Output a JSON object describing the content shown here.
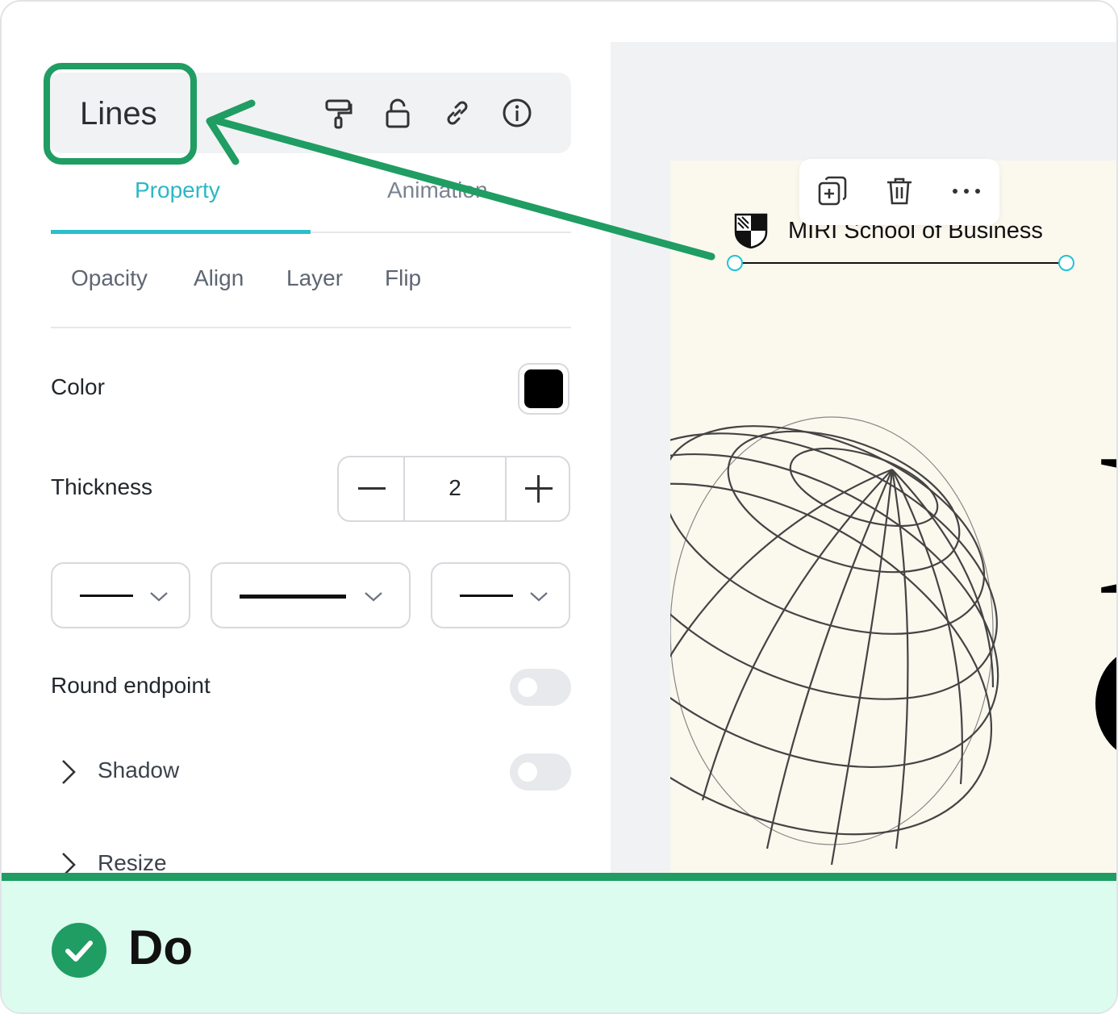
{
  "panel": {
    "title": "Lines",
    "tabs": [
      {
        "label": "Property",
        "active": true
      },
      {
        "label": "Animation",
        "active": false
      }
    ],
    "subtabs": [
      "Opacity",
      "Align",
      "Layer",
      "Flip"
    ],
    "color_label": "Color",
    "color_value": "#000000",
    "thickness_label": "Thickness",
    "thickness_value": "2",
    "round_endpoint_label": "Round endpoint",
    "round_endpoint_on": false,
    "shadow_label": "Shadow",
    "shadow_on": false,
    "resize_label": "Resize"
  },
  "canvas": {
    "brand_text": "MIRI School of Business",
    "colors": {
      "page": "#fbf8ee",
      "handle": "#22c3d6"
    }
  },
  "footer": {
    "label": "Do",
    "accent": "#1f9d62",
    "background": "#dcfcef"
  },
  "icons": {
    "toolbar": [
      "paint-roller-icon",
      "lock-icon",
      "link-icon",
      "info-icon"
    ],
    "floating": [
      "duplicate-icon",
      "trash-icon",
      "more-icon"
    ]
  }
}
